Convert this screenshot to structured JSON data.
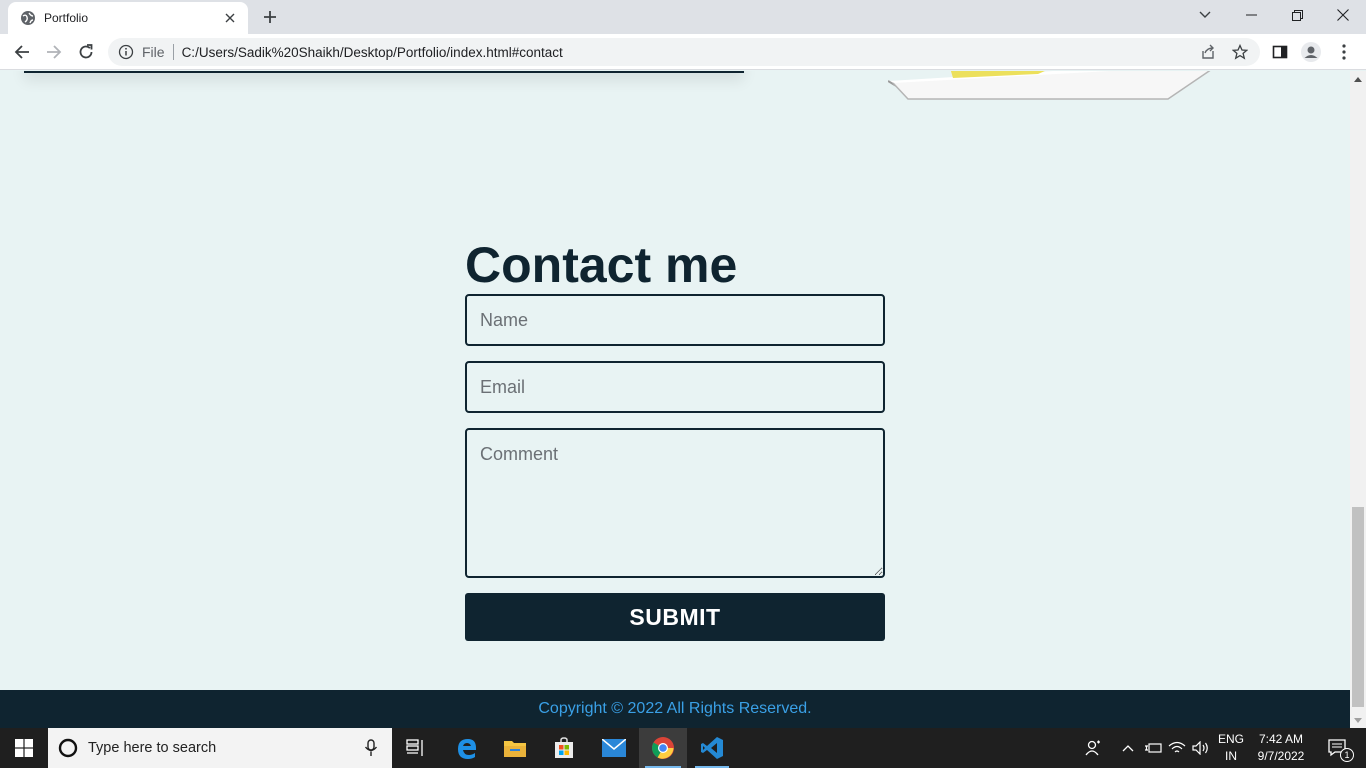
{
  "browser": {
    "tab_title": "Portfolio",
    "scheme_label": "File",
    "url": "C:/Users/Sadik%20Shaikh/Desktop/Portfolio/index.html#contact"
  },
  "contact": {
    "heading": "Contact me",
    "name_placeholder": "Name",
    "email_placeholder": "Email",
    "comment_placeholder": "Comment",
    "submit_label": "SUBMIT"
  },
  "footer": {
    "copyright": "Copyright © 2022 All Rights Reserved."
  },
  "taskbar": {
    "search_placeholder": "Type here to search",
    "language": "ENG",
    "region": "IN",
    "time": "7:42 AM",
    "date": "9/7/2022",
    "notification_count": "1"
  },
  "colors": {
    "page_background": "#e8f3f3",
    "dark_navy": "#0f2430",
    "footer_link": "#3aa0e6"
  }
}
